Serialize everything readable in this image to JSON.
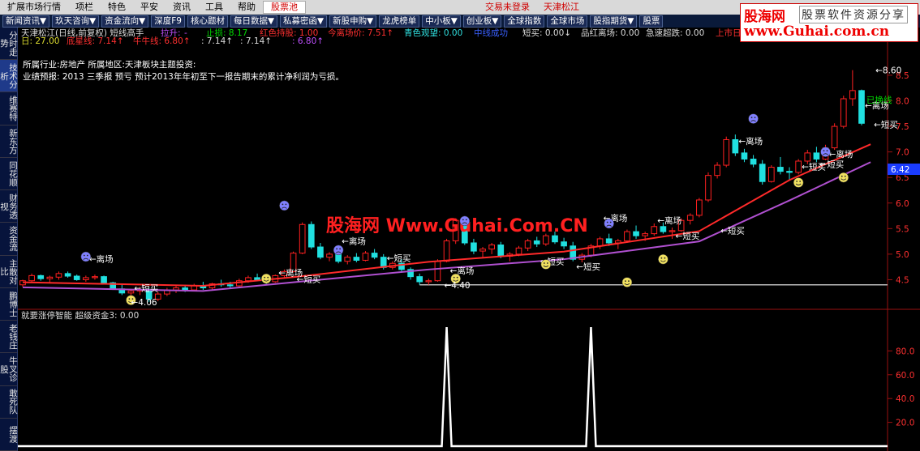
{
  "menu": {
    "items": [
      "扩展市场行情",
      "项栏",
      "特色",
      "平安",
      "资讯",
      "工具",
      "帮助",
      "股票池"
    ],
    "status": "交易未登录",
    "stock_name": "天津松江"
  },
  "toolbar": {
    "items": [
      "新闻资讯▼",
      "玖天咨询▼",
      "资金流向▼",
      "深度F9",
      "核心题材",
      "每日数据▼",
      "私募密函▼",
      "新股申购▼",
      "龙虎榜单",
      "中小板▼",
      "创业板▼",
      "全球指数",
      "全球市场",
      "股指期货▼",
      "股票"
    ]
  },
  "sidebar": {
    "items": [
      "分时走势",
      "技术分析",
      "维赛特",
      "新东方",
      "同花顺",
      "财务透视",
      "资金流",
      "主散对比",
      "鹏博士",
      "老钱庄",
      "牛叉诊股",
      "敢死队",
      "摆渡"
    ]
  },
  "logo": {
    "line1": "股海网",
    "line1b": "股票软件资源分享",
    "line2": "www.Guhai.com.cn"
  },
  "watermark": "股海网 Www.Guhai.Com.CN",
  "info": {
    "header_line1": "天津松江(日线,前复权) 短线高手",
    "lashen_label": "拉升:",
    "lashen_value": "-",
    "zhisun": "止损: 8.17",
    "hongse": "红色持股: 1.00",
    "jinlichang": "今离场价: 7.51↑",
    "qingse": "青色观望: 0.00",
    "lanse": "中线成功",
    "duanmai": "短买: 0.00↓",
    "pinhong": "品红离场: 0.00",
    "jisu": "急速超跌: 0.00",
    "shangshi": "上市日",
    "ri": "日: 27.00",
    "dixing": "底星线: 7.14↑",
    "niuniu": "牛牛线: 6.80↑",
    "v1": ": 7.14↑",
    "v2": ": 7.14↑",
    "v3": ": 6.80↑",
    "industry": "所属行业:房地产   所属地区:天津板块主题投资:",
    "forecast": "业绩预报:  2013 三季报 预亏 预计2013年年初至下一报告期末的累计净利润为亏损。",
    "sub_header": "就要涨停智能 超级资金3: 0.00"
  },
  "chart_data": {
    "type": "candlestick",
    "price_axis": {
      "ticks": [
        4.5,
        5.0,
        5.5,
        6.0,
        6.5,
        7.0,
        7.5,
        8.0,
        8.5
      ],
      "ylim": [
        4.0,
        8.8
      ]
    },
    "current_price": "6.42",
    "high_label": "8.60",
    "low_label1": "4.06",
    "low_label2": "4.40",
    "support_level": 4.4,
    "indicator_axis": {
      "ticks": [
        20.0,
        40.0,
        60.0,
        80.0
      ],
      "ylim": [
        0,
        100
      ]
    },
    "candles": [
      [
        4.4,
        4.5,
        4.36,
        4.48
      ],
      [
        4.48,
        4.62,
        4.44,
        4.58
      ],
      [
        4.58,
        4.6,
        4.48,
        4.52
      ],
      [
        4.52,
        4.58,
        4.45,
        4.55
      ],
      [
        4.55,
        4.66,
        4.5,
        4.62
      ],
      [
        4.62,
        4.66,
        4.54,
        4.57
      ],
      [
        4.57,
        4.6,
        4.48,
        4.5
      ],
      [
        4.5,
        4.58,
        4.46,
        4.54
      ],
      [
        4.54,
        4.6,
        4.5,
        4.56
      ],
      [
        4.56,
        4.58,
        4.42,
        4.44
      ],
      [
        4.44,
        4.46,
        4.3,
        4.32
      ],
      [
        4.32,
        4.4,
        4.2,
        4.24
      ],
      [
        4.24,
        4.32,
        4.16,
        4.28
      ],
      [
        4.28,
        4.36,
        4.2,
        4.3
      ],
      [
        4.3,
        4.34,
        4.06,
        4.12
      ],
      [
        4.12,
        4.26,
        4.08,
        4.22
      ],
      [
        4.22,
        4.34,
        4.18,
        4.3
      ],
      [
        4.3,
        4.38,
        4.24,
        4.34
      ],
      [
        4.34,
        4.4,
        4.26,
        4.3
      ],
      [
        4.3,
        4.42,
        4.28,
        4.38
      ],
      [
        4.38,
        4.46,
        4.3,
        4.34
      ],
      [
        4.34,
        4.44,
        4.3,
        4.42
      ],
      [
        4.42,
        4.5,
        4.36,
        4.4
      ],
      [
        4.4,
        4.46,
        4.32,
        4.38
      ],
      [
        4.38,
        4.52,
        4.34,
        4.48
      ],
      [
        4.48,
        4.58,
        4.44,
        4.54
      ],
      [
        4.54,
        4.62,
        4.48,
        4.5
      ],
      [
        4.5,
        4.56,
        4.4,
        4.46
      ],
      [
        4.46,
        4.6,
        4.44,
        4.58
      ],
      [
        4.58,
        4.7,
        4.54,
        4.66
      ],
      [
        4.66,
        5.05,
        4.64,
        5.02
      ],
      [
        5.02,
        5.62,
        5.0,
        5.58
      ],
      [
        5.58,
        5.64,
        5.1,
        5.14
      ],
      [
        5.14,
        5.22,
        4.9,
        4.94
      ],
      [
        4.94,
        5.04,
        4.86,
        5.0
      ],
      [
        5.0,
        5.08,
        4.82,
        4.86
      ],
      [
        4.86,
        4.98,
        4.8,
        4.94
      ],
      [
        4.94,
        5.02,
        4.84,
        4.88
      ],
      [
        4.88,
        5.06,
        4.86,
        5.02
      ],
      [
        5.02,
        5.1,
        4.9,
        4.94
      ],
      [
        4.94,
        5.0,
        4.7,
        4.74
      ],
      [
        4.74,
        4.86,
        4.7,
        4.82
      ],
      [
        4.82,
        4.9,
        4.66,
        4.7
      ],
      [
        4.7,
        4.74,
        4.5,
        4.56
      ],
      [
        4.56,
        4.62,
        4.4,
        4.46
      ],
      [
        4.46,
        4.52,
        4.4,
        4.48
      ],
      [
        4.48,
        4.9,
        4.46,
        4.86
      ],
      [
        4.86,
        5.3,
        4.84,
        5.26
      ],
      [
        5.26,
        5.7,
        5.2,
        5.66
      ],
      [
        5.66,
        5.72,
        5.18,
        5.22
      ],
      [
        5.22,
        5.3,
        5.0,
        5.06
      ],
      [
        5.06,
        5.14,
        4.94,
        5.1
      ],
      [
        5.1,
        5.22,
        5.0,
        5.18
      ],
      [
        5.18,
        5.24,
        4.92,
        4.96
      ],
      [
        4.96,
        5.04,
        4.86,
        5.0
      ],
      [
        5.0,
        5.16,
        4.96,
        5.12
      ],
      [
        5.12,
        5.3,
        5.06,
        5.26
      ],
      [
        5.26,
        5.34,
        5.14,
        5.2
      ],
      [
        5.2,
        5.4,
        5.16,
        5.36
      ],
      [
        5.36,
        5.44,
        5.2,
        5.24
      ],
      [
        5.24,
        5.32,
        5.1,
        5.16
      ],
      [
        5.16,
        5.24,
        4.86,
        4.9
      ],
      [
        4.9,
        5.02,
        4.84,
        4.98
      ],
      [
        4.98,
        5.2,
        4.94,
        5.16
      ],
      [
        5.16,
        5.34,
        5.1,
        5.3
      ],
      [
        5.3,
        5.4,
        5.16,
        5.22
      ],
      [
        5.22,
        5.3,
        5.1,
        5.26
      ],
      [
        5.26,
        5.48,
        5.22,
        5.44
      ],
      [
        5.44,
        5.56,
        5.3,
        5.36
      ],
      [
        5.36,
        5.44,
        5.26,
        5.4
      ],
      [
        5.4,
        5.6,
        5.36,
        5.54
      ],
      [
        5.54,
        5.62,
        5.4,
        5.44
      ],
      [
        5.44,
        5.52,
        5.3,
        5.46
      ],
      [
        5.46,
        5.7,
        5.44,
        5.66
      ],
      [
        5.66,
        5.8,
        5.58,
        5.76
      ],
      [
        5.76,
        6.1,
        5.72,
        6.06
      ],
      [
        6.06,
        6.6,
        6.02,
        6.54
      ],
      [
        6.54,
        6.8,
        6.48,
        6.74
      ],
      [
        6.74,
        7.3,
        6.7,
        7.24
      ],
      [
        7.24,
        7.34,
        6.92,
        6.98
      ],
      [
        6.98,
        7.06,
        6.8,
        6.86
      ],
      [
        6.86,
        6.94,
        6.7,
        6.76
      ],
      [
        6.76,
        6.84,
        6.36,
        6.42
      ],
      [
        6.42,
        6.74,
        6.4,
        6.7
      ],
      [
        6.7,
        6.9,
        6.56,
        6.62
      ],
      [
        6.62,
        6.7,
        6.46,
        6.6
      ],
      [
        6.6,
        6.86,
        6.56,
        6.82
      ],
      [
        6.82,
        7.04,
        6.76,
        6.98
      ],
      [
        6.98,
        7.1,
        6.8,
        6.86
      ],
      [
        6.86,
        7.14,
        6.84,
        7.08
      ],
      [
        7.08,
        7.56,
        7.04,
        7.5
      ],
      [
        7.5,
        8.1,
        7.46,
        8.04
      ],
      [
        8.04,
        8.6,
        7.9,
        8.2
      ],
      [
        8.2,
        8.22,
        7.52,
        7.56
      ]
    ],
    "ma_lines": [
      {
        "name": "red",
        "color": "#ff2a2a",
        "points": [
          [
            0,
            4.45
          ],
          [
            20,
            4.38
          ],
          [
            30,
            4.55
          ],
          [
            45,
            4.85
          ],
          [
            60,
            5.05
          ],
          [
            75,
            5.45
          ],
          [
            85,
            6.45
          ],
          [
            94,
            7.15
          ]
        ]
      },
      {
        "name": "purple",
        "color": "#b050d0",
        "points": [
          [
            0,
            4.35
          ],
          [
            20,
            4.28
          ],
          [
            30,
            4.45
          ],
          [
            45,
            4.7
          ],
          [
            60,
            4.9
          ],
          [
            75,
            5.25
          ],
          [
            85,
            6.05
          ],
          [
            94,
            6.8
          ]
        ]
      }
    ],
    "indicator_peaks": [
      {
        "index": 47,
        "value": 100
      },
      {
        "index": 63,
        "value": 100
      }
    ]
  },
  "annotations": {
    "lichang": "离场",
    "duanmai": "短买",
    "huan": "已换线",
    "smile_icon": "smiley-face-icon",
    "frown_icon": "frowning-face-icon"
  }
}
